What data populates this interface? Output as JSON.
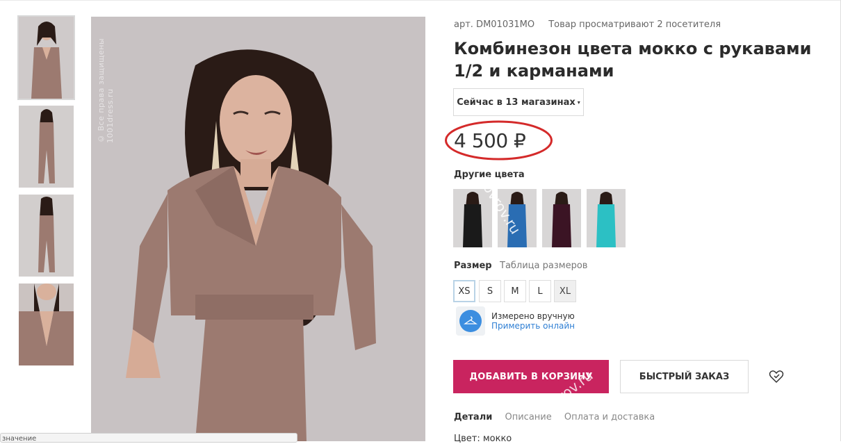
{
  "thumbnails": [
    {
      "alt": "thumb-front-closeup",
      "active": true
    },
    {
      "alt": "thumb-front-full"
    },
    {
      "alt": "thumb-back-full"
    },
    {
      "alt": "thumb-neckline-detail"
    }
  ],
  "main_photo": {
    "watermark": "© Все права защищены 1001dress.ru"
  },
  "product": {
    "article": "арт. DM01031MO",
    "viewers": "Товар просматривают 2 посетителя",
    "title": "Комбинезон цвета мокко с рукавами 1/2 и карманами",
    "stores_button": "Сейчас в 13 магазинах",
    "stores_caret": "▾",
    "price": "4 500 ₽"
  },
  "other_colors": {
    "label": "Другие цвета",
    "swatches": [
      {
        "name": "black",
        "color": "#1a1a1a"
      },
      {
        "name": "blue",
        "color": "#2a6db3"
      },
      {
        "name": "burgundy",
        "color": "#3b1424"
      },
      {
        "name": "turquoise",
        "color": "#2cc0c4"
      }
    ],
    "watermark": "kovrov.ru"
  },
  "size": {
    "label": "Размер",
    "table_link": "Таблица размеров",
    "options": [
      {
        "label": "XS",
        "selected": true
      },
      {
        "label": "S"
      },
      {
        "label": "M"
      },
      {
        "label": "L"
      },
      {
        "label": "XL",
        "disabled": true
      }
    ]
  },
  "measured": {
    "line1": "Измерено вручную",
    "line2": "Примерить онлайн"
  },
  "actions": {
    "add_to_cart": "ДОБАВИТЬ В КОРЗИНУ",
    "quick_order": "БЫСТРЫЙ ЗАКАЗ",
    "watermark": "kovrov.ru"
  },
  "tabs": [
    {
      "label": "Детали",
      "active": true
    },
    {
      "label": "Описание"
    },
    {
      "label": "Оплата и доставка"
    }
  ],
  "details": {
    "color_line": "Цвет: мокко"
  },
  "tooltip": {
    "text": "значение"
  },
  "colors": {
    "accent": "#c9245f",
    "link": "#2f7fd4",
    "price_ring": "#d42a2a",
    "dress": "#9c7a70"
  }
}
